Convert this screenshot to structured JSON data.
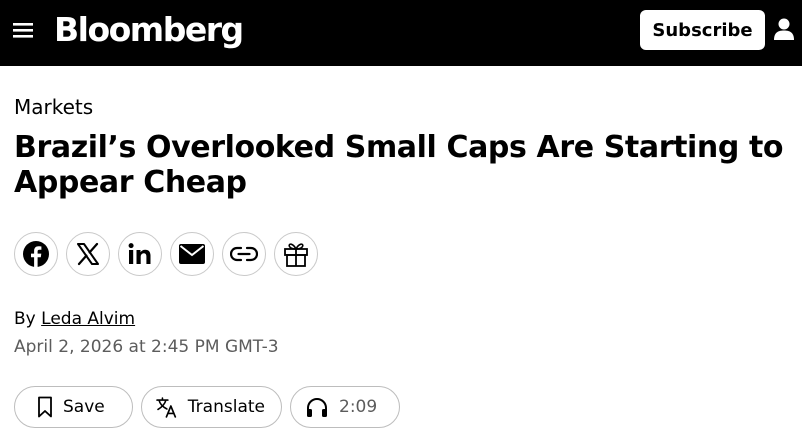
{
  "header": {
    "logo": "Bloomberg",
    "menu_icon": "hamburger-menu-icon",
    "subscribe_label": "Subscribe",
    "user_icon": "user-icon",
    "background": "#000000"
  },
  "article": {
    "section": "Markets",
    "headline": "Brazil’s Overlooked Small Caps Are Starting to Appear Cheap",
    "byline_prefix": "By",
    "author": "Leda Alvim",
    "timestamp": "April 2, 2026 at 2:45 PM GMT-3"
  },
  "share": {
    "icons": [
      "facebook-icon",
      "x-icon",
      "linkedin-icon",
      "email-icon",
      "link-icon",
      "gift-icon"
    ]
  },
  "actions": {
    "save_label": "Save",
    "translate_label": "Translate",
    "listen_duration": "2:09"
  }
}
